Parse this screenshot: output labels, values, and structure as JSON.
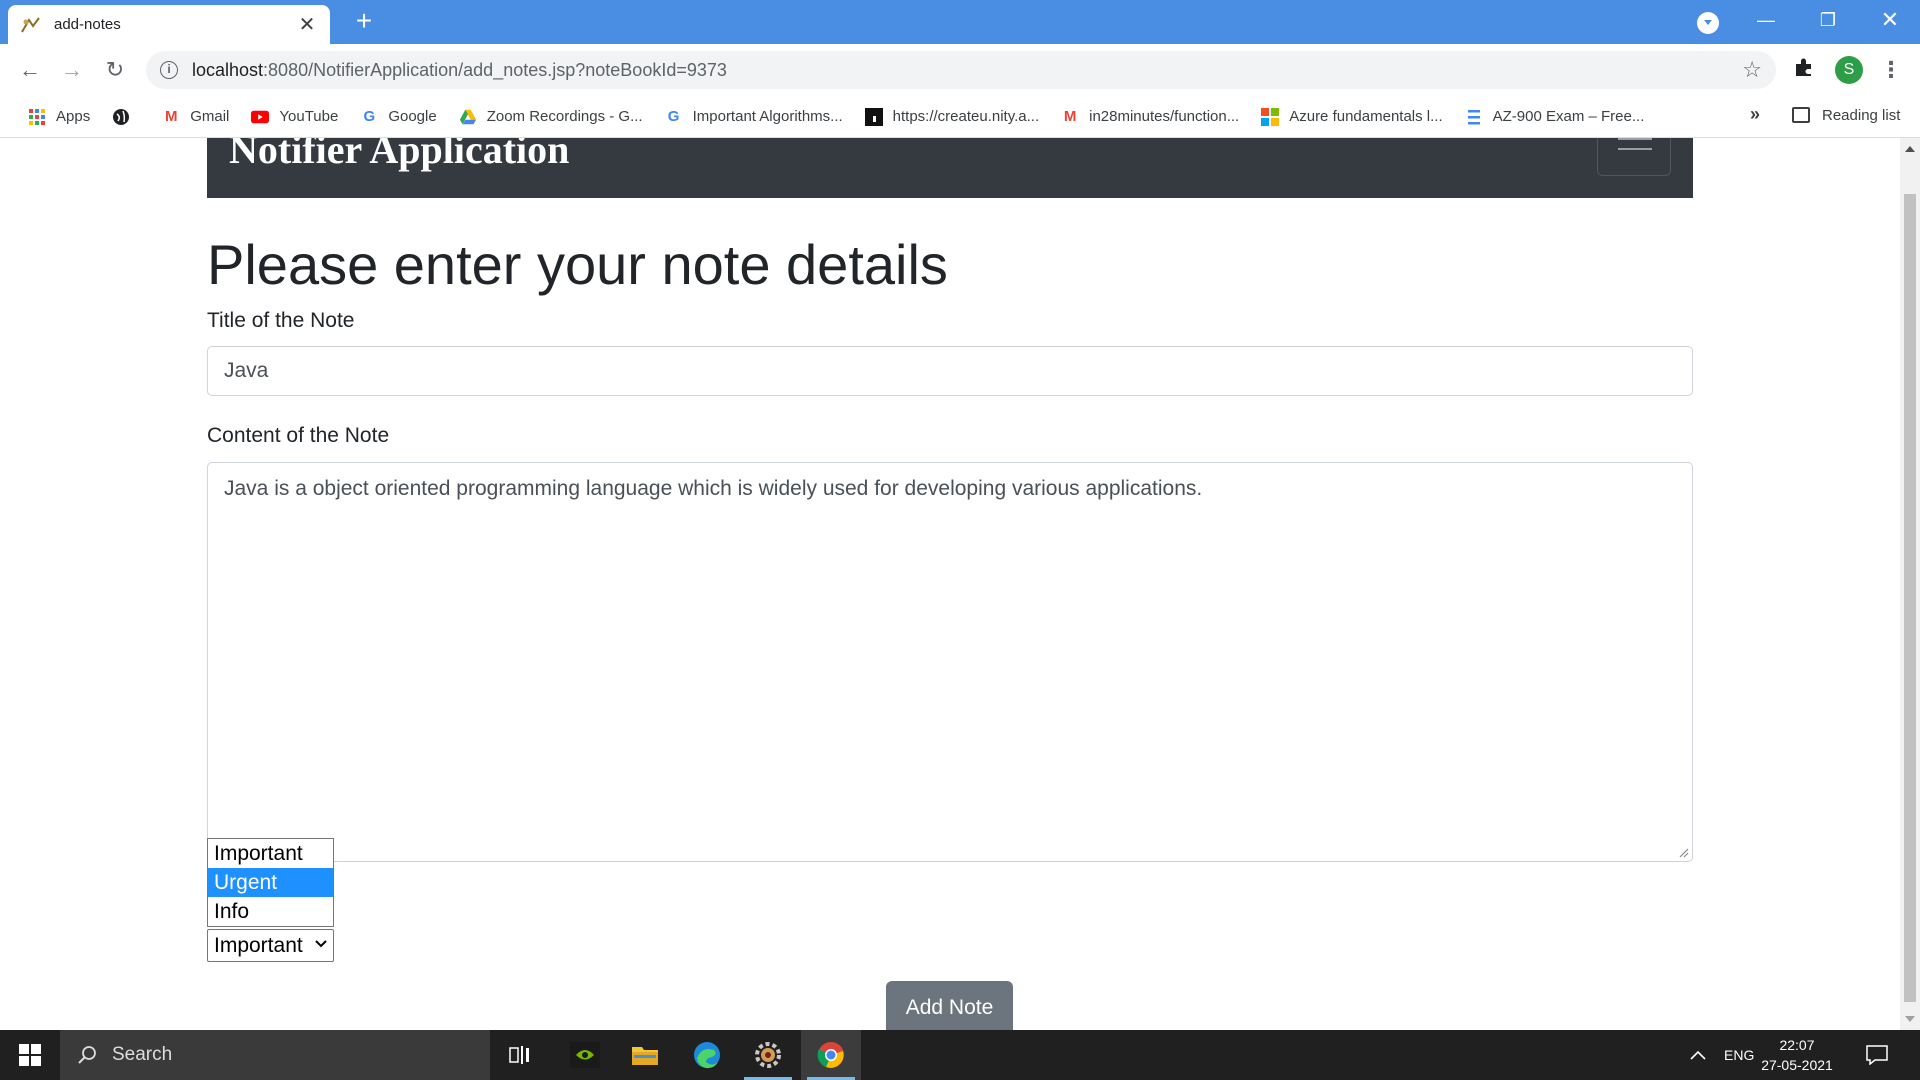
{
  "browser": {
    "tab_title": "add-notes",
    "url_host": "localhost",
    "url_path": ":8080/NotifierApplication/add_notes.jsp?noteBookId=9373",
    "avatar_letter": "S",
    "bookmarks": [
      {
        "label": "Apps",
        "icon": "apps-grid-icon"
      },
      {
        "label": "",
        "icon": "globe-icon"
      },
      {
        "label": "Gmail",
        "icon": "gmail-icon"
      },
      {
        "label": "YouTube",
        "icon": "youtube-icon"
      },
      {
        "label": "Google",
        "icon": "google-icon"
      },
      {
        "label": "Zoom Recordings - G...",
        "icon": "drive-icon"
      },
      {
        "label": "Important Algorithms...",
        "icon": "google-icon"
      },
      {
        "label": "https://createu.nity.a...",
        "icon": "site-icon"
      },
      {
        "label": "in28minutes/function...",
        "icon": "gmail-icon"
      },
      {
        "label": "Azure fundamentals l...",
        "icon": "microsoft-icon"
      },
      {
        "label": "AZ-900 Exam – Free...",
        "icon": "doc-icon"
      }
    ],
    "overflow": "»",
    "reading_list": "Reading list"
  },
  "page": {
    "brand": "Notifier Application",
    "heading": "Please enter your note details",
    "title_label": "Title of the Note",
    "title_value": "Java",
    "content_label": "Content of the Note",
    "content_value": "Java is a object oriented programming language which is widely used for developing various applications.",
    "dropdown_options": [
      "Important",
      "Urgent",
      "Info"
    ],
    "highlighted_option": "Urgent",
    "selected_value": "Important",
    "submit_label": "Add Note"
  },
  "taskbar": {
    "search_placeholder": "Search",
    "language": "ENG",
    "time": "22:07",
    "date": "27-05-2021"
  },
  "colors": {
    "tabstrip": "#4a8ee4",
    "navbar": "#343a40",
    "button": "#6c757d",
    "highlight": "#1e90ff"
  }
}
